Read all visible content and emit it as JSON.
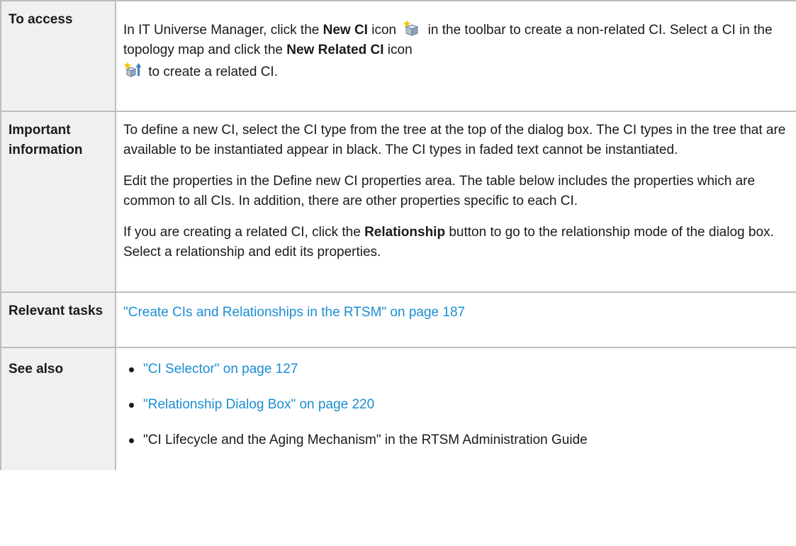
{
  "rows": {
    "access": {
      "label": "To access",
      "text_1": "In IT Universe Manager, click the ",
      "bold_new_ci": "New CI",
      "text_2": " icon ",
      "text_3": " in the toolbar to create a non-related CI. Select a CI in the topology map and click the ",
      "bold_new_related_ci": "New Related CI",
      "text_4": " icon ",
      "text_5": " to create a related CI."
    },
    "important": {
      "label": "Important information",
      "para_1": "To define a new CI, select the CI type from the tree at the top of the dialog box. The CI types in the tree that are available to be instantiated appear in black. The CI types in faded text cannot be instantiated.",
      "para_2": "Edit the properties in the Define new CI properties area. The table below includes the properties which are common to all CIs. In addition, there are other properties specific to each CI.",
      "para_3_a": "If you are creating a related CI, click the ",
      "para_3_bold": "Relationship",
      "para_3_b": " button to go to the relationship mode of the dialog box. Select a relationship and edit its properties."
    },
    "tasks": {
      "label": "Relevant tasks",
      "link": "\"Create CIs and Relationships in the RTSM\" on page 187"
    },
    "see_also": {
      "label": "See also",
      "link_1": "\"CI Selector\" on page 127",
      "link_2": "\"Relationship Dialog Box\" on page 220",
      "item_3": "\"CI Lifecycle and the Aging Mechanism\" in the RTSM Administration Guide"
    }
  },
  "icons": {
    "new_ci": "new-ci-icon",
    "new_related_ci": "new-related-ci-icon"
  }
}
